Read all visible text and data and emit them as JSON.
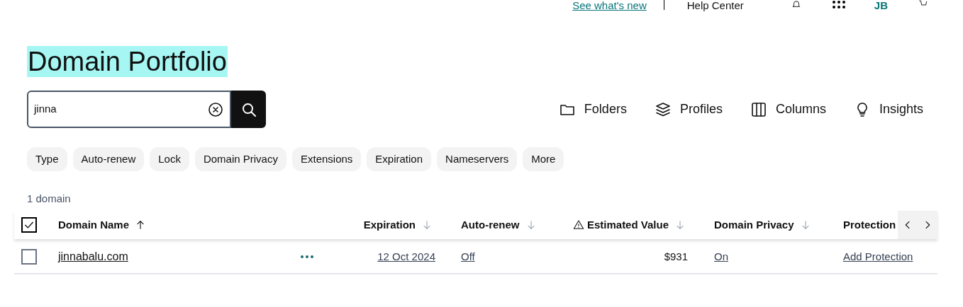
{
  "top_bar": {
    "link": "See what's new",
    "help": "Help Center",
    "avatar": "JB"
  },
  "title": "Domain Portfolio",
  "search": {
    "value": "jinna"
  },
  "toolbar": [
    {
      "kind": "folder",
      "label": "Folders"
    },
    {
      "kind": "layers",
      "label": "Profiles"
    },
    {
      "kind": "columns",
      "label": "Columns"
    },
    {
      "kind": "bulb",
      "label": "Insights"
    }
  ],
  "filters": [
    "Type",
    "Auto-renew",
    "Lock",
    "Domain Privacy",
    "Extensions",
    "Expiration",
    "Nameservers",
    "More"
  ],
  "count": "1 domain",
  "table": {
    "select_all": {
      "checked": true
    },
    "columns": [
      {
        "label": "Domain Name",
        "ascending": true,
        "active": true
      },
      {
        "label": "Expiration",
        "ascending": false,
        "active": false
      },
      {
        "label": "Auto-renew",
        "ascending": false,
        "active": false
      },
      {
        "label": "Estimated Value",
        "ascending": false,
        "active": false
      },
      {
        "label": "Domain Privacy",
        "ascending": false,
        "active": false
      },
      {
        "label": "Protection"
      }
    ],
    "rows": [
      {
        "checked": false,
        "domain": "jinnabalu.com",
        "expiration": "12 Oct 2024",
        "auto_renew": "Off",
        "estimated_value": "$931",
        "domain_privacy": "On",
        "protection": "Add Protection"
      }
    ]
  }
}
